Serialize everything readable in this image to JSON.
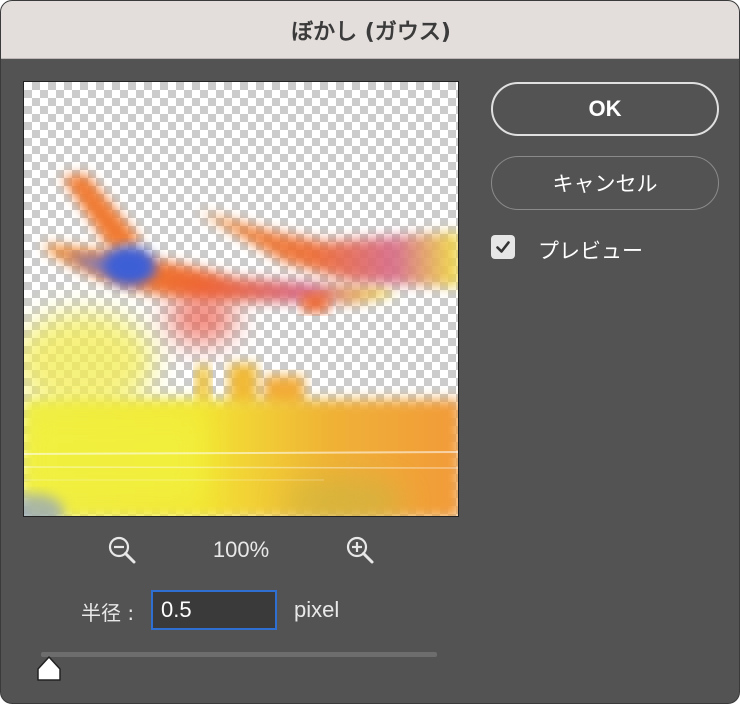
{
  "dialog": {
    "title": "ぼかし (ガウス)"
  },
  "buttons": {
    "ok_label": "OK",
    "cancel_label": "キャンセル"
  },
  "preview_option": {
    "label": "プレビュー",
    "checked": true
  },
  "zoom": {
    "level": "100%",
    "zoom_out_icon": "zoom-out-icon",
    "zoom_in_icon": "zoom-in-icon"
  },
  "radius": {
    "label": "半径 :",
    "value": "0.5",
    "unit": "pixel",
    "slider_fraction": 0.0
  },
  "colors": {
    "dialog_background": "#535353",
    "titlebar_background": "#e3dedc",
    "input_focus_border": "#2f6fd2",
    "image_orange": "#ee7233",
    "image_yellow": "#f5e636",
    "image_blue": "#3e5fd6"
  }
}
